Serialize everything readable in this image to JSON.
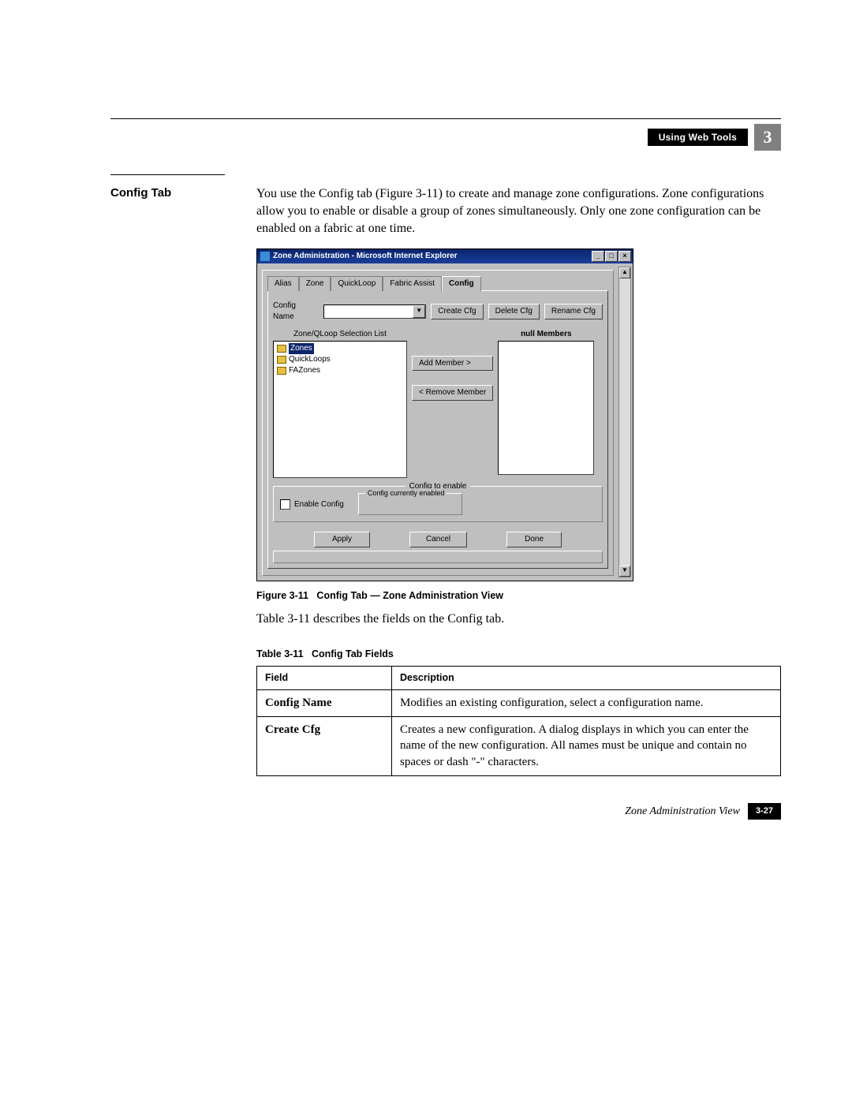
{
  "header": {
    "section_title": "Using Web Tools",
    "chapter_number": "3"
  },
  "section": {
    "label": "Config Tab",
    "paragraph": "You use the Config tab (Figure 3-11) to create and manage zone configurations. Zone configurations allow you to enable or disable a group of zones simultaneously. Only one zone configuration can be enabled on a fabric at one time."
  },
  "screenshot": {
    "window_title": "Zone Administration - Microsoft Internet Explorer",
    "tabs": [
      "Alias",
      "Zone",
      "QuickLoop",
      "Fabric Assist",
      "Config"
    ],
    "active_tab": "Config",
    "config_name_label": "Config Name",
    "buttons": {
      "create": "Create Cfg",
      "delete": "Delete Cfg",
      "rename": "Rename Cfg",
      "add_member": "Add Member >",
      "remove_member": "< Remove Member",
      "apply": "Apply",
      "cancel": "Cancel",
      "done": "Done"
    },
    "left_list_header": "Zone/QLoop Selection List",
    "right_list_header": "null Members",
    "tree": [
      "Zones",
      "QuickLoops",
      "FAZones"
    ],
    "enable_label": "Enable Config",
    "group1_legend": "Config to enable",
    "group2_legend": "Config currently enabled"
  },
  "figure_caption": {
    "num": "Figure 3-11",
    "text": "Config Tab — Zone Administration View"
  },
  "between_text": "Table 3-11 describes the fields on the Config tab.",
  "table_caption": {
    "num": "Table 3-11",
    "text": "Config Tab Fields"
  },
  "table": {
    "headers": [
      "Field",
      "Description"
    ],
    "rows": [
      {
        "field": "Config Name",
        "desc": "Modifies an existing configuration, select a configuration name."
      },
      {
        "field": "Create Cfg",
        "desc": "Creates a new configuration. A dialog displays in which you can enter the name of the new configuration. All names must be unique and contain no spaces or dash \"-\" characters."
      }
    ]
  },
  "footer": {
    "text": "Zone Administration View",
    "page": "3-27"
  }
}
